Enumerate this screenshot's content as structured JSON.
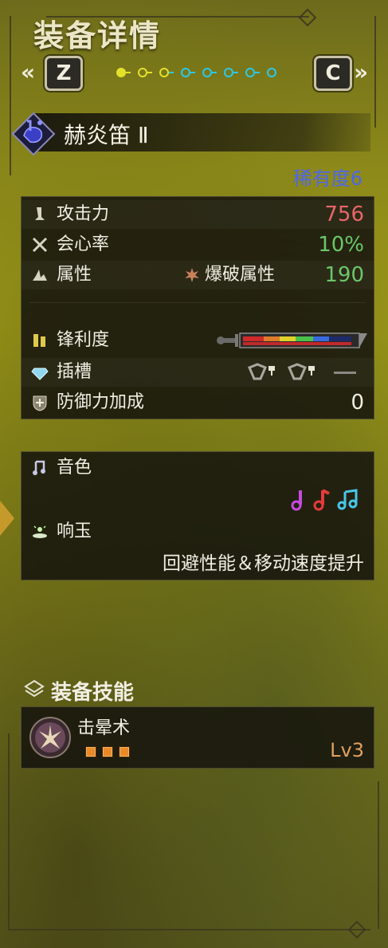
{
  "header": {
    "title": "装备详情",
    "left_key": "Z",
    "right_key": "C",
    "left_chevron": "«",
    "right_chevron": "»",
    "page_indicator": {
      "total": 8,
      "current": 1,
      "yellow_count": 3
    }
  },
  "weapon": {
    "name": "赫炎笛 Ⅱ",
    "rarity": "稀有度6",
    "icon": "hunting-horn-icon"
  },
  "stats": {
    "attack_label": "攻击力",
    "attack_value": "756",
    "affinity_label": "会心率",
    "affinity_value": "10%",
    "element_label": "属性",
    "element_type": "爆破属性",
    "element_value": "190",
    "sharpness_label": "锋利度",
    "slots_label": "插槽",
    "defense_label": "防御力加成",
    "defense_value": "0"
  },
  "horn": {
    "melody_label": "音色",
    "notes": [
      "purple",
      "red",
      "cyan"
    ],
    "echo_label": "响玉",
    "echo_value": "回避性能＆移动速度提升"
  },
  "skills": {
    "section_label": "装备技能",
    "items": [
      {
        "name": "击晕术",
        "level": "Lv3",
        "pips": 3
      }
    ]
  },
  "colors": {
    "attack": "#e8666a",
    "affinity": "#6ac76a",
    "element": "#6ac76a",
    "rarity": "#4f67e8",
    "skill_level": "#e0a060"
  }
}
